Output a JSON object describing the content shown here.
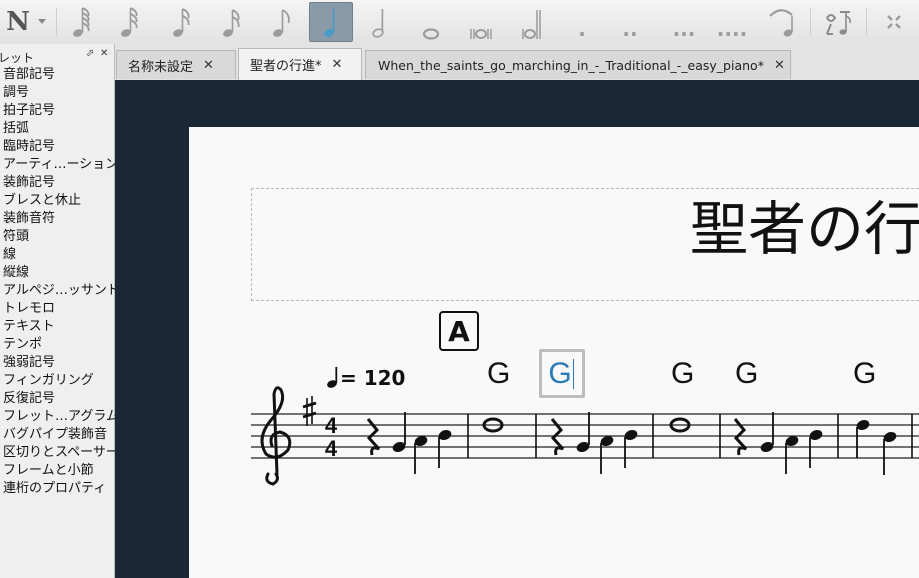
{
  "toolbar": {
    "buttons": [
      {
        "icon": "note-input-icon",
        "label": "N"
      },
      {
        "icon": "dropdown-arrow-icon"
      },
      {
        "icon": "128th-note-icon"
      },
      {
        "icon": "64th-note-icon"
      },
      {
        "icon": "32nd-note-icon"
      },
      {
        "icon": "16th-note-icon"
      },
      {
        "icon": "eighth-note-icon"
      },
      {
        "icon": "quarter-note-icon",
        "active": true
      },
      {
        "icon": "half-note-icon"
      },
      {
        "icon": "whole-note-icon"
      },
      {
        "icon": "breve-icon"
      },
      {
        "icon": "longa-icon"
      },
      {
        "icon": "augmentation-dot-icon",
        "label": "."
      },
      {
        "icon": "double-dot-icon",
        "label": ".."
      },
      {
        "icon": "triple-dot-icon",
        "label": "..."
      },
      {
        "icon": "quadruple-dot-icon",
        "label": "...."
      },
      {
        "icon": "tie-icon"
      },
      {
        "icon": "flip-direction-icon"
      },
      {
        "icon": "toggle-icon"
      }
    ],
    "accent": "#4c9ac7"
  },
  "palette": {
    "title": "レット",
    "items": [
      "音部記号",
      "調号",
      "拍子記号",
      "括弧",
      "臨時記号",
      "アーティ…ーション",
      "装飾記号",
      "ブレスと休止",
      "装飾音符",
      "符頭",
      "線",
      "縦線",
      "アルペジ…ッサンド",
      "トレモロ",
      "テキスト",
      "テンポ",
      "強弱記号",
      "フィンガリング",
      "反復記号",
      "フレット…アグラム",
      "バグパイプ装飾音",
      "区切りとスペーサー",
      "フレームと小節",
      "連桁のプロパティ"
    ]
  },
  "tabs": [
    {
      "label": "名称未設定"
    },
    {
      "label": "聖者の行進*",
      "active": true
    },
    {
      "label": "When_the_saints_go_marching_in_-_Traditional_-_easy_piano*"
    }
  ],
  "score": {
    "title": "聖者の行",
    "rehearsal_mark": "A",
    "tempo": "= 120",
    "chords": [
      "G",
      "G",
      "G",
      "G",
      "G"
    ],
    "selected_chord_index": 1,
    "time_signature": {
      "numerator": "4",
      "denominator": "4"
    }
  },
  "colors": {
    "canvas_background": "#1a2734",
    "page_background": "#f9f9f9",
    "selection_text": "#2a7ab8"
  }
}
